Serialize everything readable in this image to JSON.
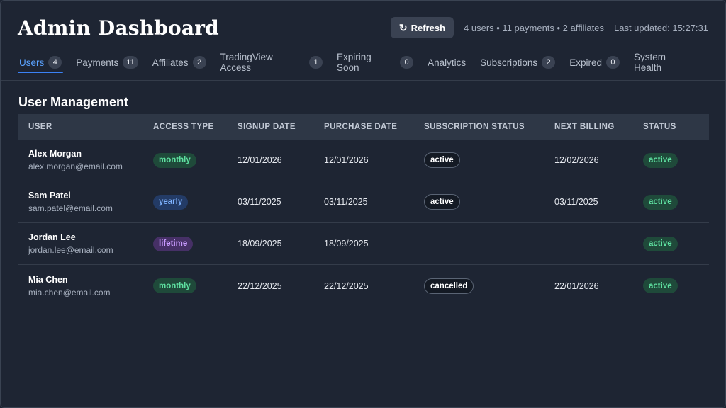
{
  "header": {
    "title": "Admin Dashboard",
    "refresh_label": "Refresh",
    "summary": "4 users • 11 payments • 2 affiliates",
    "last_updated": "Last updated: 15:27:31"
  },
  "tabs": [
    {
      "label": "Users",
      "count": "4",
      "active": true
    },
    {
      "label": "Payments",
      "count": "11"
    },
    {
      "label": "Affiliates",
      "count": "2"
    },
    {
      "label": "TradingView Access",
      "count": "1"
    },
    {
      "label": "Expiring Soon",
      "count": "0"
    },
    {
      "label": "Analytics",
      "count": null
    },
    {
      "label": "Subscriptions",
      "count": "2"
    },
    {
      "label": "Expired",
      "count": "0"
    },
    {
      "label": "System Health",
      "count": null
    }
  ],
  "section_title": "User Management",
  "table": {
    "columns": [
      "USER",
      "ACCESS TYPE",
      "SIGNUP DATE",
      "PURCHASE DATE",
      "SUBSCRIPTION STATUS",
      "NEXT BILLING",
      "STATUS"
    ],
    "rows": [
      {
        "name": "Alex Morgan",
        "email": "alex.morgan@email.com",
        "access": "monthly",
        "signup": "12/01/2026",
        "purchase": "12/01/2026",
        "subscription": "active",
        "next_billing": "12/02/2026",
        "status": "active"
      },
      {
        "name": "Sam Patel",
        "email": "sam.patel@email.com",
        "access": "yearly",
        "signup": "03/11/2025",
        "purchase": "03/11/2025",
        "subscription": "active",
        "next_billing": "03/11/2025",
        "status": "active"
      },
      {
        "name": "Jordan Lee",
        "email": "jordan.lee@email.com",
        "access": "lifetime",
        "signup": "18/09/2025",
        "purchase": "18/09/2025",
        "subscription": "—",
        "next_billing": "—",
        "status": "active"
      },
      {
        "name": "Mia Chen",
        "email": "mia.chen@email.com",
        "access": "monthly",
        "signup": "22/12/2025",
        "purchase": "22/12/2025",
        "subscription": "cancelled",
        "next_billing": "22/01/2026",
        "status": "active"
      }
    ]
  },
  "colors": {
    "background": "#1e2533",
    "accent": "#3b82f6",
    "monthly": "#5ee0a0",
    "yearly": "#7fb3ff",
    "lifetime": "#c99bff"
  },
  "icons": {
    "refresh": "refresh-icon"
  }
}
